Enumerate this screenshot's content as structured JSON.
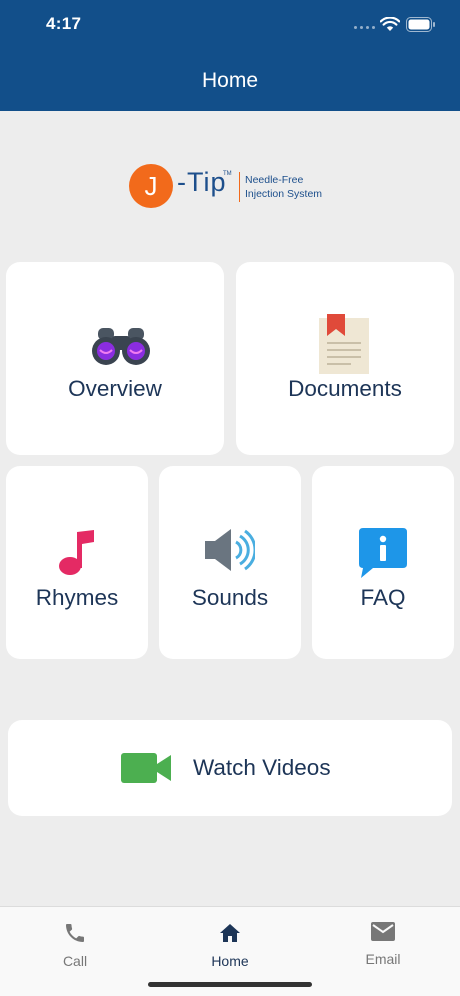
{
  "status_bar": {
    "time": "4:17"
  },
  "header": {
    "title": "Home"
  },
  "logo": {
    "letter": "J",
    "word": "-Tip",
    "tm": "TM",
    "tagline_1": "Needle-Free",
    "tagline_2": "Injection System"
  },
  "tiles": {
    "overview": "Overview",
    "documents": "Documents",
    "rhymes": "Rhymes",
    "sounds": "Sounds",
    "faq": "FAQ",
    "videos": "Watch Videos"
  },
  "tabbar": [
    {
      "label": "Call",
      "icon": "phone-icon",
      "active": false
    },
    {
      "label": "Home",
      "icon": "home-icon",
      "active": true
    },
    {
      "label": "Email",
      "icon": "mail-icon",
      "active": false
    }
  ],
  "colors": {
    "header": "#124f8a",
    "accent": "#f26a1b",
    "label": "#1d3557",
    "tab_active": "#1d3557",
    "tab_inactive": "#777777"
  }
}
